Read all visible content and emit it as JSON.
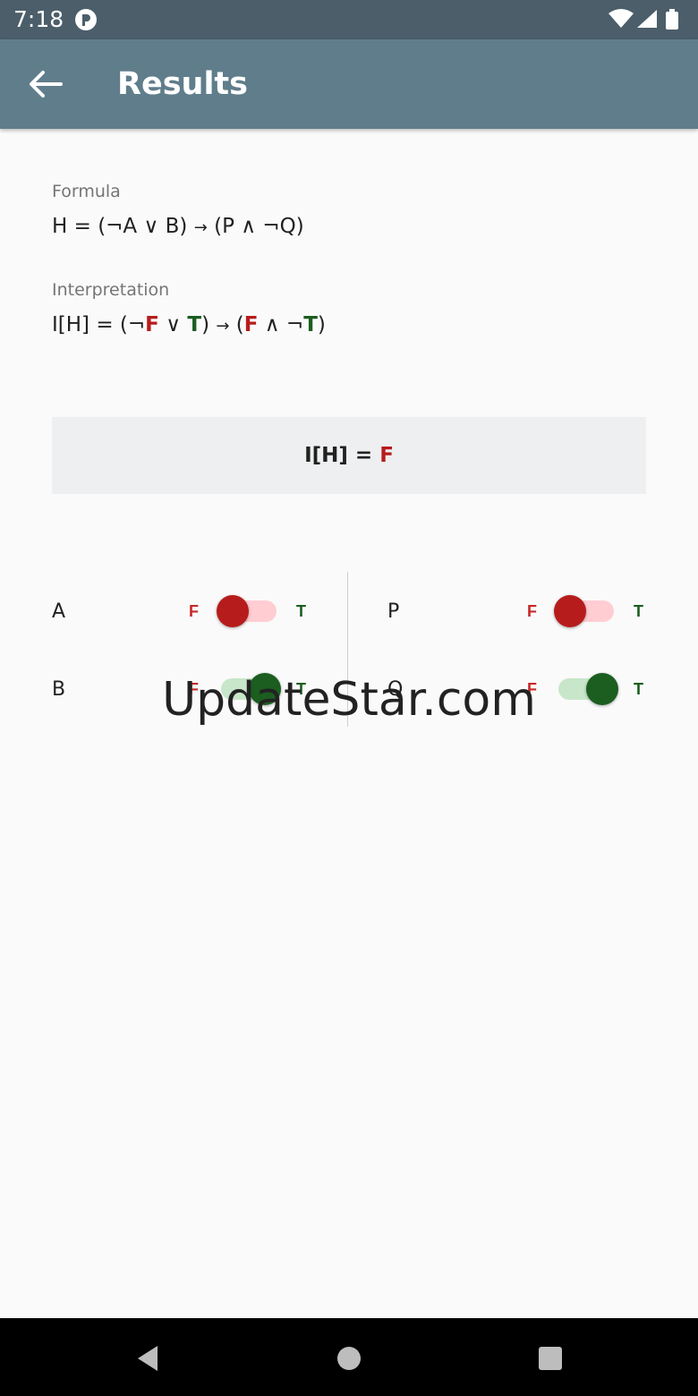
{
  "status_bar": {
    "time": "7:18"
  },
  "app_bar": {
    "title": "Results"
  },
  "formula": {
    "label": "Formula",
    "left": "H = (¬A ∨ B) ",
    "arrow": "→",
    "right": " (P ∧ ¬Q)"
  },
  "interpretation": {
    "label": "Interpretation",
    "p1": "I[H] = (¬",
    "a": "F",
    "p2": " ∨ ",
    "b": "T",
    "p3": ") ",
    "arrow": "→",
    "p4": " (",
    "p": "F",
    "p5": " ∧ ¬",
    "q": "T",
    "p6": ")"
  },
  "result": {
    "prefix": "I[H] = ",
    "value": "F"
  },
  "variables": [
    {
      "name": "A",
      "false_label": "F",
      "true_label": "T",
      "value": false
    },
    {
      "name": "B",
      "false_label": "F",
      "true_label": "T",
      "value": true
    },
    {
      "name": "P",
      "false_label": "F",
      "true_label": "T",
      "value": false
    },
    {
      "name": "Q",
      "false_label": "F",
      "true_label": "T",
      "value": true
    }
  ],
  "watermark": "UpdateStar.com",
  "colors": {
    "app_bar": "#607d8b",
    "status_bar": "#4b5e6a",
    "false": "#b71c1c",
    "true": "#1b5e20"
  }
}
